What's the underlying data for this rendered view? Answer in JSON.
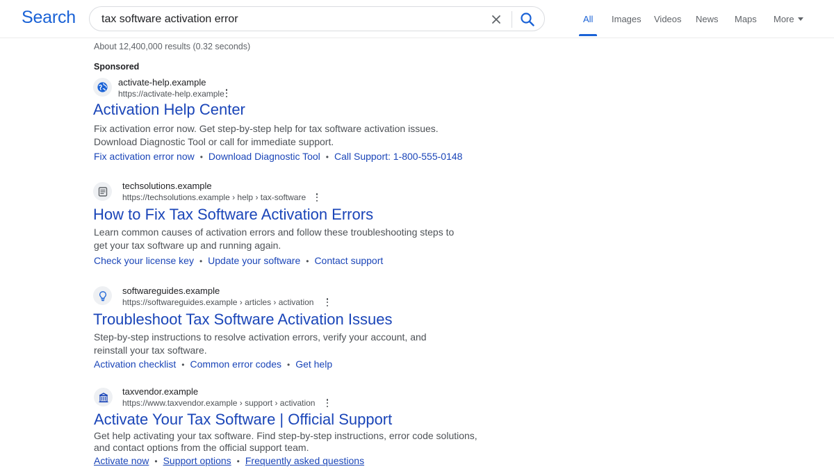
{
  "app": {
    "logo_text": "Search",
    "accent_color": "#1a62d6",
    "link_color": "#1a45b8"
  },
  "search": {
    "query": "tax software activation error",
    "clear_icon": "close-icon",
    "submit_icon": "search-icon"
  },
  "tabs": [
    {
      "label": "All",
      "active": true
    },
    {
      "label": "Images",
      "active": false
    },
    {
      "label": "Videos",
      "active": false
    },
    {
      "label": "News",
      "active": false
    },
    {
      "label": "Maps",
      "active": false
    },
    {
      "label": "More",
      "active": false
    }
  ],
  "stats": "About 12,400,000 results (0.32 seconds)",
  "sponsored_label": "Sponsored",
  "results": [
    {
      "icon": "globe-icon",
      "site": "activate-help.example",
      "url": "https://activate-help.example",
      "title": "Activation Help Center",
      "snippet": [
        "Fix activation error now. Get step-by-step help for tax software activation issues.",
        "Download Diagnostic Tool or call for immediate support."
      ],
      "sitelinks": [
        "Fix activation error now",
        "Download Diagnostic Tool",
        "Call Support: 1-800-555-0148"
      ]
    },
    {
      "icon": "document-icon",
      "site": "techsolutions.example",
      "url": "https://techsolutions.example › help › tax-software",
      "title": "How to Fix Tax Software Activation Errors",
      "snippet": [
        "Learn common causes of activation errors and follow these troubleshooting steps to",
        "get your tax software up and running again."
      ],
      "sitelinks": [
        "Check your license key",
        "Update your software",
        "Contact support"
      ]
    },
    {
      "icon": "lightbulb-icon",
      "site": "softwareguides.example",
      "url": "https://softwareguides.example › articles › activation",
      "title": "Troubleshoot Tax Software Activation Issues",
      "snippet": [
        "Step-by-step instructions to resolve activation errors, verify your account, and",
        "reinstall your tax software."
      ],
      "sitelinks": [
        "Activation checklist",
        "Common error codes",
        "Get help"
      ]
    },
    {
      "icon": "building-icon",
      "site": "taxvendor.example",
      "url": "https://www.taxvendor.example › support › activation",
      "title": "Activate Your Tax Software | Official Support",
      "snippet": [
        "Get help activating your tax software. Find step-by-step instructions, error code solutions,",
        "and contact options from the official support team."
      ],
      "sitelinks": [
        "Activate now",
        "Support options",
        "Frequently asked questions"
      ]
    }
  ]
}
